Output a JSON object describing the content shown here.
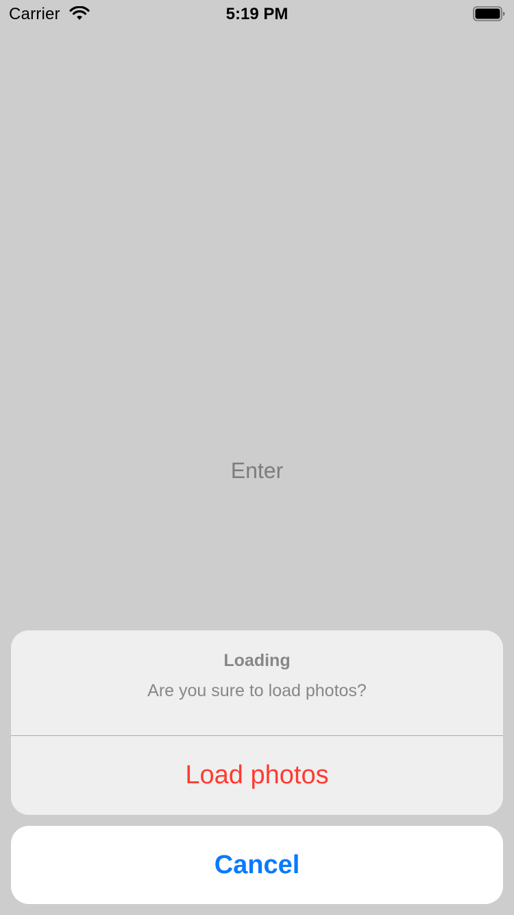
{
  "status_bar": {
    "carrier": "Carrier",
    "time": "5:19 PM",
    "wifi_icon": "wifi-icon",
    "battery_icon": "battery-icon"
  },
  "main": {
    "center_text": "Enter"
  },
  "action_sheet": {
    "title": "Loading",
    "message": "Are you sure to load photos?",
    "actions": [
      {
        "label": "Load photos",
        "style": "destructive",
        "color": "#ff3b30"
      }
    ],
    "cancel": {
      "label": "Cancel",
      "color": "#0a7aff"
    }
  }
}
